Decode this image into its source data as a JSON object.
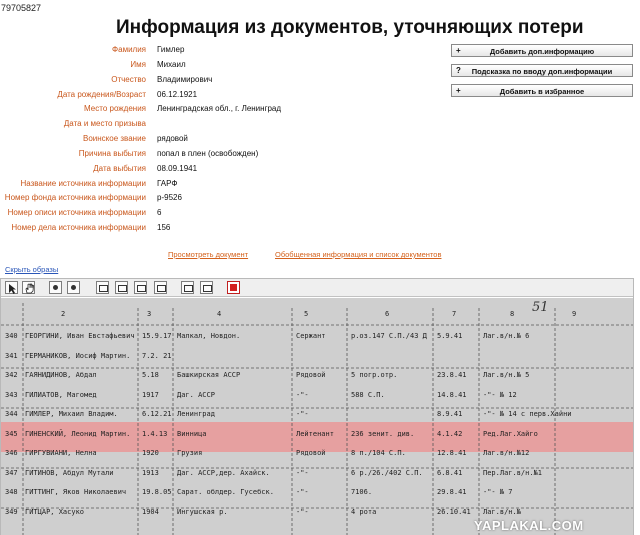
{
  "record_id": "79705827",
  "title": "Информация из документов, уточняющих потери",
  "fields": [
    {
      "label": "Фамилия",
      "value": "Гимлер"
    },
    {
      "label": "Имя",
      "value": "Михаил"
    },
    {
      "label": "Отчество",
      "value": "Владимирович"
    },
    {
      "label": "Дата рождения/Возраст",
      "value": "06.12.1921"
    },
    {
      "label": "Место рождения",
      "value": "Ленинградская обл., г. Ленинград"
    },
    {
      "label": "Дата и место призыва",
      "value": ""
    },
    {
      "label": "Воинское звание",
      "value": "рядовой"
    },
    {
      "label": "Причина выбытия",
      "value": "попал в плен (освобожден)"
    },
    {
      "label": "Дата выбытия",
      "value": "08.09.1941"
    },
    {
      "label": "Название источника информации",
      "value": "ГАРФ"
    },
    {
      "label": "Номер фонда источника информации",
      "value": "р-9526"
    },
    {
      "label": "Номер описи источника информации",
      "value": "6"
    },
    {
      "label": "Номер дела источника информации",
      "value": "156"
    }
  ],
  "actions": [
    {
      "symbol": "+",
      "label": "Добавить доп.информацию"
    },
    {
      "symbol": "?",
      "label": "Подсказка по вводу доп.информации"
    },
    {
      "symbol": "+",
      "label": "Добавить в избранное"
    }
  ],
  "links": {
    "view_document": "Просмотреть документ",
    "summary": "Обобщенная информация и список документов",
    "hide_images": "Скрыть образы"
  },
  "toolbar_icons": [
    "select-arrow-icon",
    "hand-pan-icon",
    "zoom-in-icon",
    "zoom-out-icon",
    "fit-page-icon",
    "actual-size-icon",
    "fit-width-icon",
    "fit-height-icon",
    "print-icon",
    "thumbnails-icon",
    "pdf-icon"
  ],
  "document": {
    "page_number": "51",
    "column_numbers": [
      "1",
      "2",
      "3",
      "4",
      "5",
      "6",
      "7",
      "8",
      "9"
    ],
    "highlight_color": "#e9a0a0",
    "rows": [
      {
        "num": "340",
        "name": "ГЕОРГИНИ, Иван Евстафьевич",
        "year": "15.9.17",
        "place": "Малкал, Новдон.",
        "rank": "Сержант",
        "unit": "р.оз.147 С.П./43 Д",
        "date": "5.9.41",
        "note": "Лаг.в/н.№ 6"
      },
      {
        "num": "341",
        "name": "ГЕРМАНИКОВ, Иосиф Мартин.",
        "year": "7.2. 21",
        "place": "",
        "rank": "",
        "unit": "",
        "date": "",
        "note": ""
      },
      {
        "num": "342",
        "name": "ГАЯНИДИНОВ, Абдал",
        "year": "5.18",
        "place": "Башкирская АССР",
        "rank": "Рядовой",
        "unit": "5 погр.отр.",
        "date": "23.8.41",
        "note": "Лаг.в/н.№ 5"
      },
      {
        "num": "343",
        "name": "ГИЛИАТОВ, Магомед",
        "year": "1917",
        "place": "Даг. АССР",
        "rank": "-\"-",
        "unit": "588 С.П.",
        "date": "14.8.41",
        "note": "-\"- № 12"
      },
      {
        "num": "344",
        "name": "ГИМЛЕР, Михаил Владим.",
        "year": "6.12.21",
        "place": "Ленинград",
        "rank": "-\"-",
        "unit": "",
        "date": "8.9.41",
        "note": "-\"- № 14 с перв.Хайни"
      },
      {
        "num": "345",
        "name": "ГИНЕНСКИЙ, Леонид Мартин.",
        "year": "1.4.13",
        "place": "Винница",
        "rank": "Лейтенант",
        "unit": "236 зенит. див.",
        "date": "4.1.42",
        "note": "Ред.Лаг.Хайго"
      },
      {
        "num": "346",
        "name": "ГИРГУВИАНИ, Нелна",
        "year": "1920",
        "place": "Грузия",
        "rank": "Рядовой",
        "unit": "8 п./104 С.П.",
        "date": "12.8.41",
        "note": "Лаг.в/н.№12"
      },
      {
        "num": "347",
        "name": "ГИТИНОВ, Абдул Мутали",
        "year": "1913",
        "place": "Даг. АССР,дер. Ахайск.",
        "rank": "-\"-",
        "unit": "6 р./26./402 С.П.",
        "date": "6.8.41",
        "note": "Пер.Лаг.в/н.№1"
      },
      {
        "num": "348",
        "name": "ГИТТИНГ, Яков Николаевич",
        "year": "19.8.05",
        "place": "Сарат. облдер. Гусебск.",
        "rank": "-\"-",
        "unit": "7106.",
        "date": "29.8.41",
        "note": "-\"- № 7"
      },
      {
        "num": "349",
        "name": "ГИТЦАР, Хасуко",
        "year": "1904",
        "place": "Ингушская р.",
        "rank": "-\"-",
        "unit": "4 рота",
        "date": "26.10.41",
        "note": "Лаг.в/н.№"
      }
    ],
    "watermark": "YAPLAKAL.COM"
  }
}
